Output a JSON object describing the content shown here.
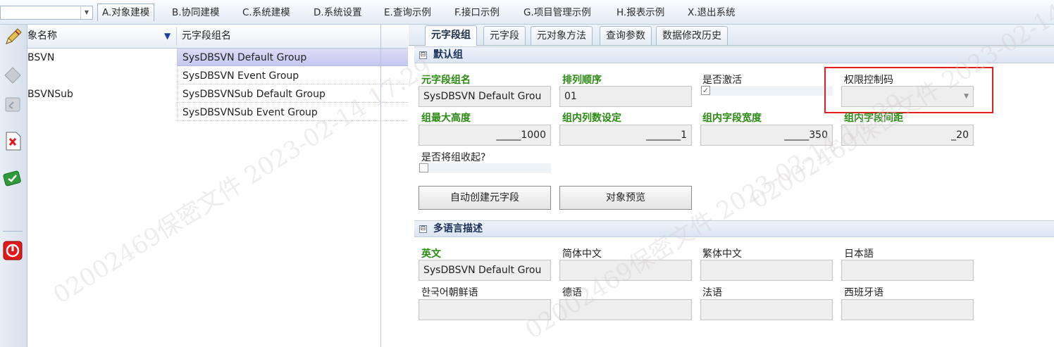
{
  "menubar": {
    "combo_value": "",
    "items": [
      {
        "label": "A.对象建模",
        "active": true
      },
      {
        "label": "B.协同建模"
      },
      {
        "label": "C.系统建模"
      },
      {
        "label": "D.系统设置"
      },
      {
        "label": "E.查询示例"
      },
      {
        "label": "F.接口示例"
      },
      {
        "label": "G.项目管理示例"
      },
      {
        "label": "H.报表示例"
      },
      {
        "label": "X.退出系统"
      }
    ]
  },
  "toolbar": {
    "icons": [
      "edit-pencil-icon",
      "disabled-save-icon",
      "disabled-undo-icon",
      "delete-icon",
      "confirm-icon",
      "exit-icon"
    ]
  },
  "grid": {
    "columns": [
      "象名称",
      "元字段组名"
    ],
    "rows": [
      {
        "object": "BSVN",
        "group": "SysDBSVN Default Group",
        "selected": true
      },
      {
        "object": "",
        "group": "SysDBSVN Event Group"
      },
      {
        "object": "BSVNSub",
        "group": "SysDBSVNSub Default Group"
      },
      {
        "object": "",
        "group": "SysDBSVNSub Event Group"
      }
    ]
  },
  "tabs": [
    "元字段组",
    "元字段",
    "元对象方法",
    "查询参数",
    "数据修改历史"
  ],
  "default_group": {
    "title": "默认组",
    "expander": "⊟",
    "fields": {
      "group_name": {
        "label": "元字段组名",
        "value": "SysDBSVN Default Grou"
      },
      "sort_order": {
        "label": "排列顺序",
        "value": "01"
      },
      "is_active": {
        "label": "是否激活",
        "checked": true
      },
      "permission_code": {
        "label": "权限控制码",
        "value": ""
      },
      "max_height": {
        "label": "组最大高度",
        "value": "_____1000"
      },
      "col_count": {
        "label": "组内列数设定",
        "value": "_______1"
      },
      "field_width": {
        "label": "组内字段宽度",
        "value": "_____350"
      },
      "field_spacing": {
        "label": "组内字段间距",
        "value": "_20"
      },
      "collapse": {
        "label": "是否将组收起?",
        "checked": false
      }
    },
    "buttons": {
      "auto_create": "自动创建元字段",
      "preview": "对象预览"
    }
  },
  "lang_group": {
    "title": "多语言描述",
    "expander": "⊟",
    "fields": {
      "english": {
        "label": "英文",
        "value": "SysDBSVN Default Grou"
      },
      "simplified": {
        "label": "简体中文",
        "value": ""
      },
      "traditional": {
        "label": "繁体中文",
        "value": ""
      },
      "japanese": {
        "label": "日本語",
        "value": ""
      },
      "korean": {
        "label": "한국어朝鲜语",
        "value": ""
      },
      "german": {
        "label": "德语",
        "value": ""
      },
      "french": {
        "label": "法语",
        "value": ""
      },
      "spanish": {
        "label": "西班牙语",
        "value": ""
      }
    }
  },
  "watermark": "02002469保密文件 2023-02-14 17:29",
  "colors": {
    "highlight": "#e02020",
    "selected_row": "#c5c8f0",
    "green_label": "#2a8a12"
  }
}
